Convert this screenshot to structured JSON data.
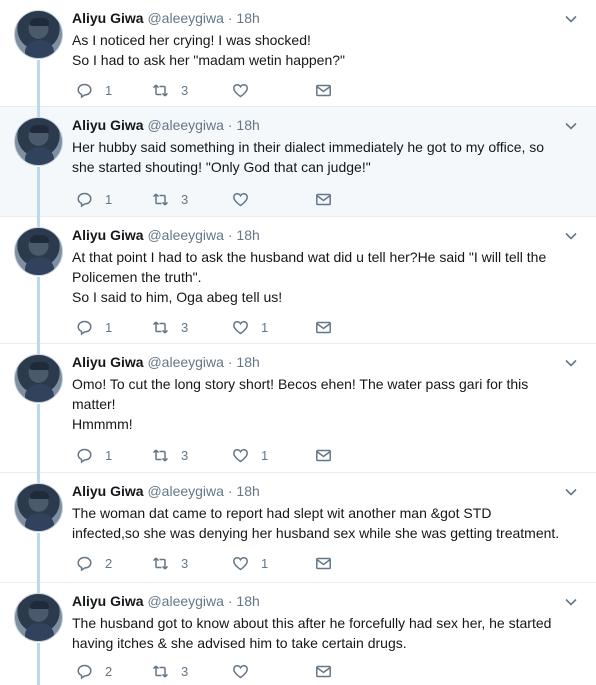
{
  "tweets": [
    {
      "name": "Aliyu Giwa",
      "handle": "@aleeygiwa",
      "separator": "·",
      "time": "18h",
      "lines": [
        "As I noticed her crying! I was shocked!",
        "So I had to ask her \"madam wetin happen?\""
      ],
      "replies": "1",
      "retweets": "3",
      "likes": ""
    },
    {
      "name": "Aliyu Giwa",
      "handle": "@aleeygiwa",
      "separator": "·",
      "time": "18h",
      "lines": [
        "Her hubby said something in their dialect immediately he got to my office, so",
        "she started shouting! \"Only God that can judge!\""
      ],
      "replies": "1",
      "retweets": "3",
      "likes": ""
    },
    {
      "name": "Aliyu Giwa",
      "handle": "@aleeygiwa",
      "separator": "·",
      "time": "18h",
      "lines": [
        "At that point I had to ask the husband wat did u tell her?He said \"I will tell the",
        "Policemen the truth\".",
        "So I said to him, Oga abeg tell us!"
      ],
      "replies": "1",
      "retweets": "3",
      "likes": "1"
    },
    {
      "name": "Aliyu Giwa",
      "handle": "@aleeygiwa",
      "separator": "·",
      "time": "18h",
      "lines": [
        "Omo! To cut the long story short! Becos ehen! The water pass gari for this",
        "matter!",
        "Hmmmm!"
      ],
      "replies": "1",
      "retweets": "3",
      "likes": "1"
    },
    {
      "name": "Aliyu Giwa",
      "handle": "@aleeygiwa",
      "separator": "·",
      "time": "18h",
      "lines": [
        "The woman dat came to report had slept wit another man &got STD",
        "infected,so she was denying her husband sex while she was getting treatment."
      ],
      "replies": "2",
      "retweets": "3",
      "likes": "1"
    },
    {
      "name": "Aliyu Giwa",
      "handle": "@aleeygiwa",
      "separator": "·",
      "time": "18h",
      "lines": [
        "The husband got to know about this after he forcefully had sex her, he started",
        "having itches & she advised him to take certain drugs."
      ],
      "replies": "2",
      "retweets": "3",
      "likes": ""
    }
  ],
  "icons": {
    "reply": "reply-icon",
    "retweet": "retweet-icon",
    "like": "heart-icon",
    "dm": "envelope-icon",
    "menu": "chevron-down-icon"
  },
  "colors": {
    "thread_line": "#b8d9ef",
    "highlight_bg": "#f5f8fa",
    "muted": "#657786"
  }
}
